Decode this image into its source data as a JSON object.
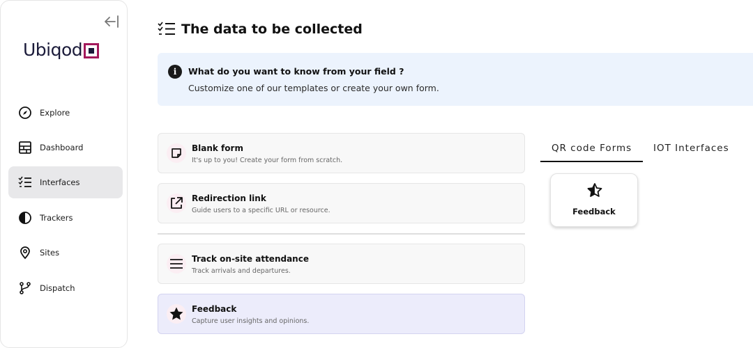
{
  "sidebar": {
    "logo_text": "Ubiqod",
    "items": [
      {
        "label": "Explore",
        "icon": "compass-icon"
      },
      {
        "label": "Dashboard",
        "icon": "dashboard-icon"
      },
      {
        "label": "Interfaces",
        "icon": "checklist-icon",
        "active": true
      },
      {
        "label": "Trackers",
        "icon": "half-circle-icon"
      },
      {
        "label": "Sites",
        "icon": "map-pin-icon"
      },
      {
        "label": "Dispatch",
        "icon": "branch-icon"
      }
    ]
  },
  "page": {
    "title": "The data to be collected"
  },
  "info": {
    "title": "What do you want to know from your field ?",
    "subtitle": "Customize one of our templates or create your own form."
  },
  "options": [
    {
      "title": "Blank form",
      "subtitle": "It's up to you! Create your form from scratch.",
      "icon": "sticky-note-icon"
    },
    {
      "title": "Redirection link",
      "subtitle": "Guide users to a specific URL or resource.",
      "icon": "external-link-icon"
    },
    {
      "title": "Track on-site attendance",
      "subtitle": "Track arrivals and departures.",
      "icon": "menu-lines-icon"
    },
    {
      "title": "Feedback",
      "subtitle": "Capture user insights and opinions.",
      "icon": "star-icon",
      "selected": true
    }
  ],
  "tabs": [
    {
      "label": "QR code Forms",
      "active": true
    },
    {
      "label": "IOT Interfaces",
      "active": false
    }
  ],
  "qr_card": {
    "label": "Feedback",
    "icon": "half-star-icon"
  },
  "colors": {
    "brand": "#a3195b",
    "info_bg": "#ecf3fd",
    "selected_bg": "#ececfb",
    "active_nav_bg": "#e8e8ea"
  }
}
